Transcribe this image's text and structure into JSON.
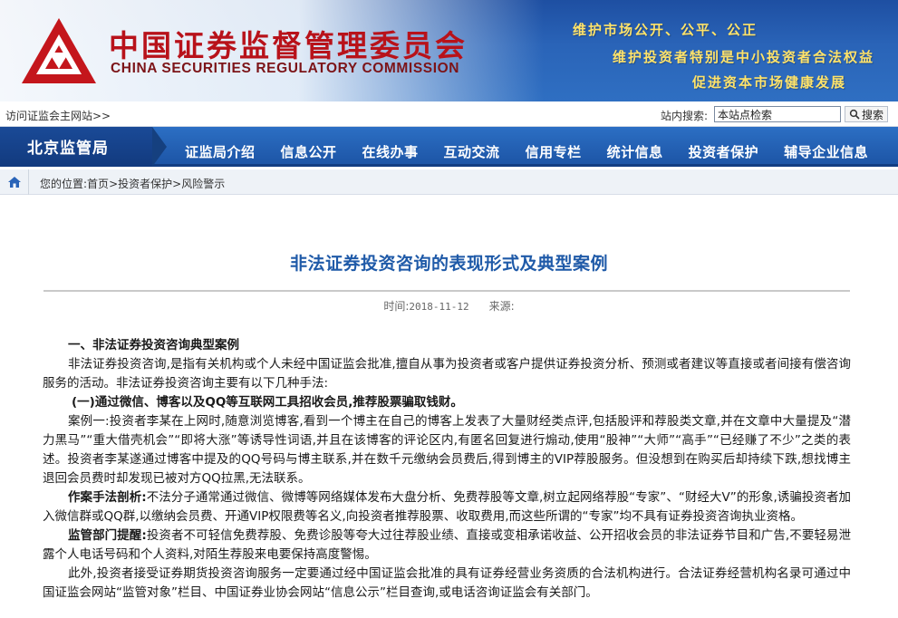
{
  "header": {
    "org_name_cn": "中国证券监督管理委员会",
    "org_name_en": "CHINA SECURITIES REGULATORY COMMISSION",
    "slogans": [
      "维护市场公开、公平、公正",
      "维护投资者特别是中小投资者合法权益",
      "促进资本市场健康发展"
    ],
    "brand_red": "#b8121a",
    "brand_blue": "#1e4fa2",
    "slogan_color": "#ffe36a"
  },
  "util": {
    "visit_link": "访问证监会主网站>>",
    "search_label": "站内搜索:",
    "search_value": "本站点检索",
    "search_button": "搜索",
    "search_icon": "magnifier-icon"
  },
  "nav": {
    "bureau": "北京监管局",
    "items": [
      "证监局介绍",
      "信息公开",
      "在线办事",
      "互动交流",
      "信用专栏",
      "统计信息",
      "投资者保护",
      "辅导企业信息"
    ]
  },
  "breadcrumb": {
    "home_icon": "home-icon",
    "prefix": "您的位置:",
    "items": [
      "首页",
      "投资者保护",
      "风险警示"
    ],
    "separator": ">"
  },
  "article": {
    "title": "非法证券投资咨询的表现形式及典型案例",
    "date_label": "时间:",
    "date": "2018-11-12",
    "source_label": "来源:",
    "source": "",
    "section1": "一、非法证券投资咨询典型案例",
    "intro": "非法证券投资咨询,是指有关机构或个人未经中国证监会批准,擅自从事为投资者或客户提供证券投资分析、预测或者建议等直接或者间接有偿咨询服务的活动。非法证券投资咨询主要有以下几种手法:",
    "sub1": "(一)通过微信、博客以及QQ等互联网工具招收会员,推荐股票骗取钱财。",
    "case1": "案例一:投资者李某在上网时,随意浏览博客,看到一个博主在自己的博客上发表了大量财经类点评,包括股评和荐股类文章,并在文章中大量提及“潜力黑马”“重大借壳机会”“即将大涨”等诱导性词语,并且在该博客的评论区内,有匿名回复进行煽动,使用“股神”“大师”“高手”“已经赚了不少”之类的表述。投资者李某遂通过博客中提及的QQ号码与博主联系,并在数千元缴纳会员费后,得到博主的VIP荐股服务。但没想到在购买后却持续下跌,想找博主退回会员费时却发现已被对方QQ拉黑,无法联系。",
    "modus_label": "作案手法剖析:",
    "modus_text": "不法分子通常通过微信、微博等网络媒体发布大盘分析、免费荐股等文章,树立起网络荐股“专家”、“财经大V”的形象,诱骗投资者加入微信群或QQ群,以缴纳会员费、开通VIP权限费等名义,向投资者推荐股票、收取费用,而这些所谓的“专家”均不具有证券投资咨询执业资格。",
    "warning_label": "监管部门提醒:",
    "warning_text": "投资者不可轻信免费荐股、免费诊股等夸大过往荐股业绩、直接或变相承诺收益、公开招收会员的非法证券节目和广告,不要轻易泄露个人电话号码和个人资料,对陌生荐股来电要保持高度警惕。",
    "extra": "此外,投资者接受证券期货投资咨询服务一定要通过经中国证监会批准的具有证券经营业务资质的合法机构进行。合法证券经营机构名录可通过中国证监会网站“监管对象”栏目、中国证券业协会网站“信息公示”栏目查询,或电话咨询证监会有关部门。"
  }
}
